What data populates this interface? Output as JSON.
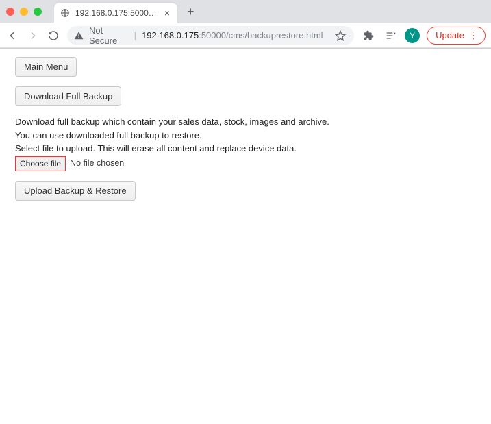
{
  "browser": {
    "tab_title": "192.168.0.175:50000/cms/bac",
    "security_label": "Not Secure",
    "url_host": "192.168.0.175",
    "url_rest": ":50000/cms/backuprestore.html",
    "update_label": "Update",
    "avatar_letter": "Y"
  },
  "page": {
    "main_menu_label": "Main Menu",
    "download_btn_label": "Download Full Backup",
    "desc_line1": "Download full backup which contain your sales data, stock, images and archive.",
    "desc_line2": "You can use downloaded full backup to restore.",
    "desc_line3": "Select file to upload. This will erase all content and replace device data.",
    "choose_file_label": "Choose file",
    "file_status": "No file chosen",
    "upload_btn_label": "Upload Backup & Restore"
  }
}
